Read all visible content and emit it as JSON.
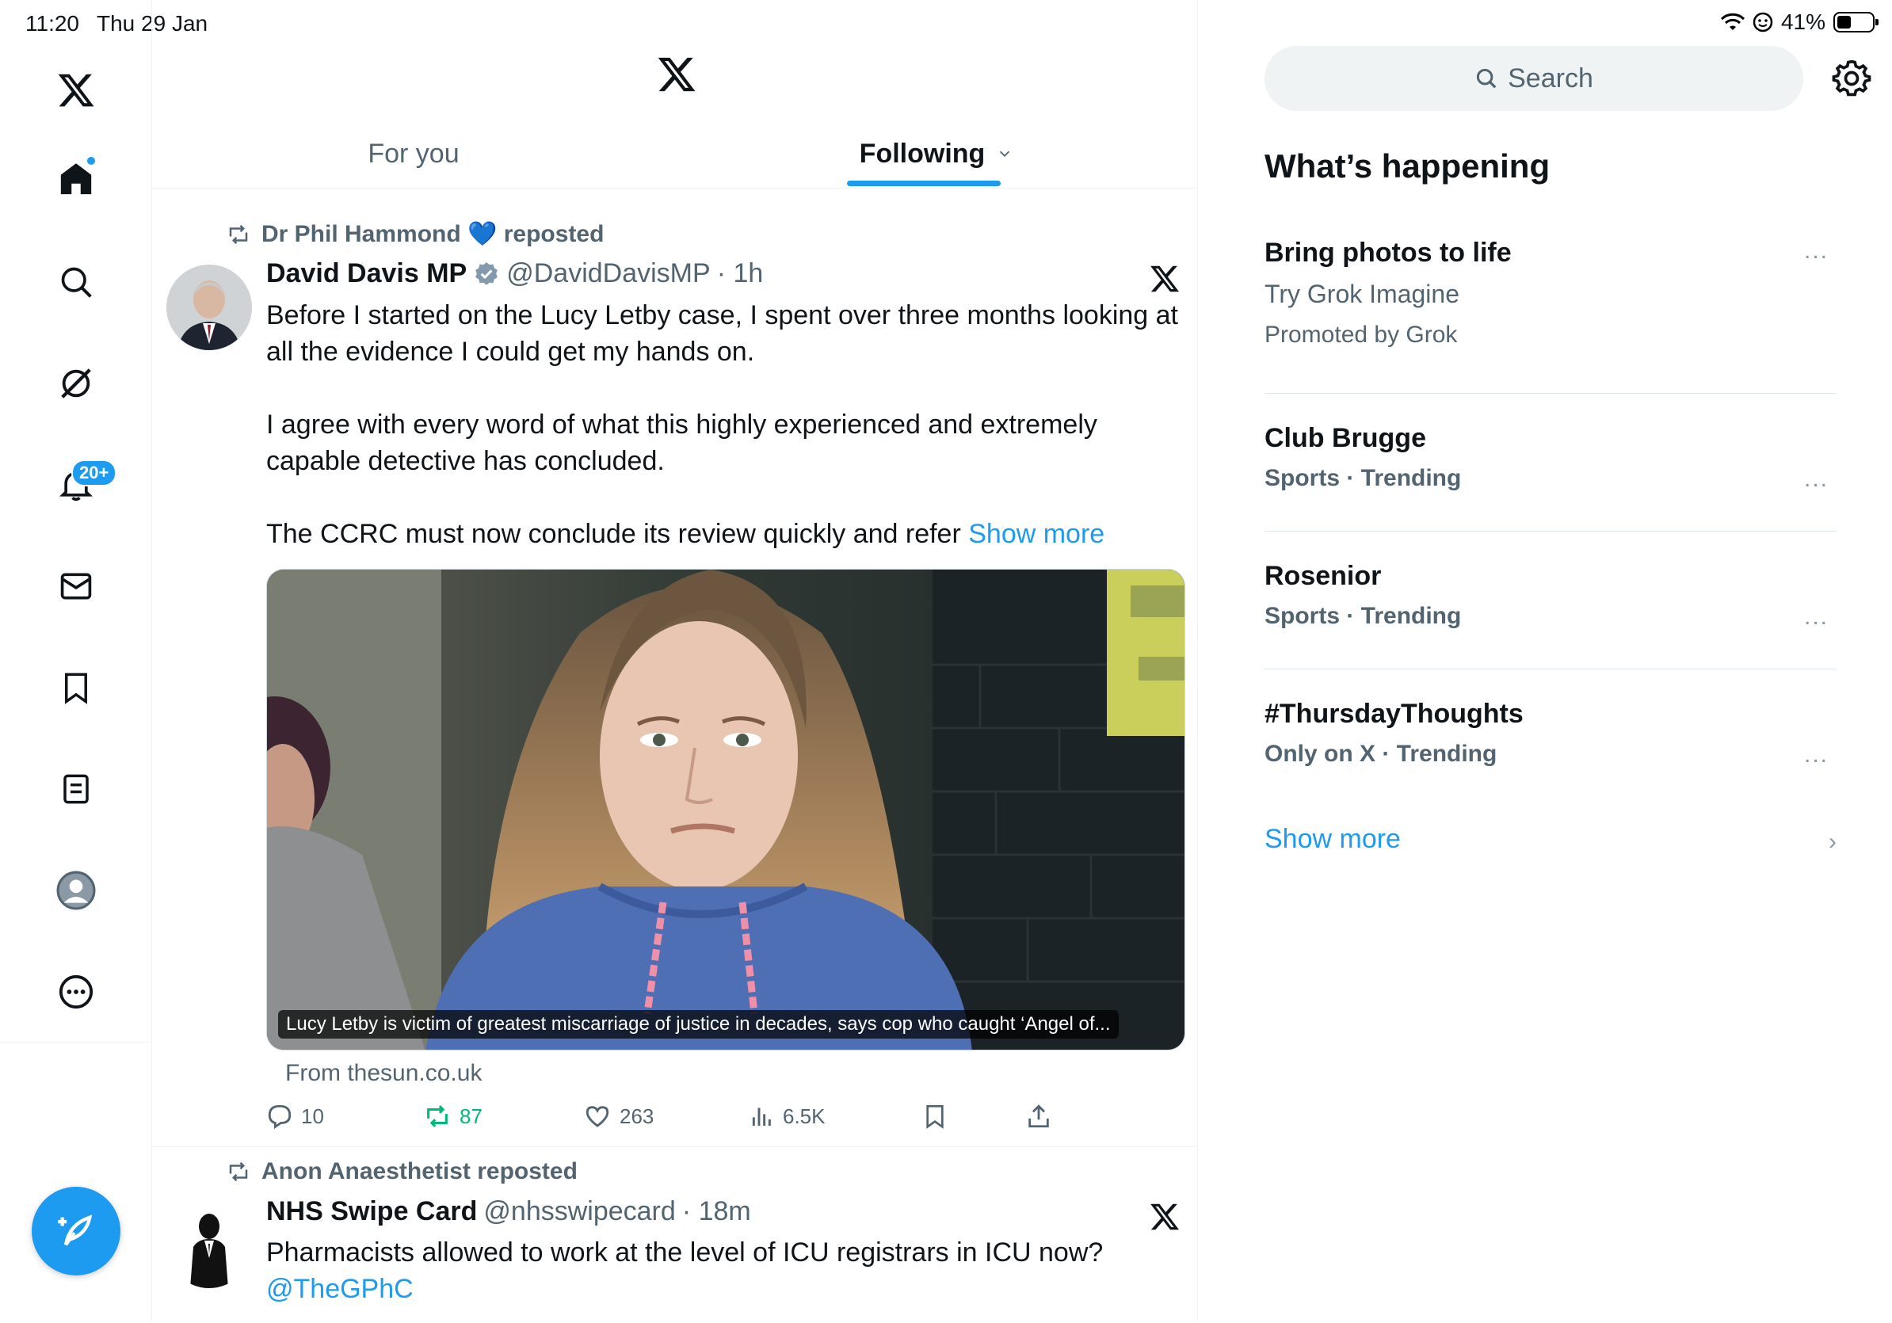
{
  "status_bar": {
    "time": "11:20",
    "date": "Thu 29 Jan",
    "battery": "41%",
    "battery_level": 0.41
  },
  "nav": {
    "notifications_badge": "20+"
  },
  "tabs": {
    "for_you": "For you",
    "following": "Following"
  },
  "post1": {
    "reposter": "Dr Phil Hammond 💙 reposted",
    "name": "David Davis MP",
    "handle": "@DavidDavisMP",
    "time": "· 1h",
    "paragraph1": "Before I started on the Lucy Letby case, I spent over three months looking at all the evidence I could get my hands on.",
    "paragraph2": "I agree with every word of what this highly experienced and extremely capable detective has concluded.",
    "paragraph3": "The CCRC must now conclude its review quickly and refer ",
    "show_more": "Show more",
    "media_caption": "Lucy Letby is victim of greatest miscarriage of justice in decades, says cop who caught ‘Angel of...",
    "source": "From thesun.co.uk",
    "replies": "10",
    "reposts": "87",
    "likes": "263",
    "views": "6.5K"
  },
  "post2": {
    "reposter": "Anon Anaesthetist reposted",
    "name": "NHS Swipe Card",
    "handle": "@nhsswipecard",
    "time": "· 18m",
    "text": "Pharmacists allowed to work at the level of ICU registrars in ICU now?",
    "mention": "@TheGPhC"
  },
  "sidebar": {
    "search_placeholder": "Search",
    "title": "What’s happening",
    "promo": {
      "title": "Bring photos to life",
      "subtitle": "Try Grok Imagine",
      "promoted": "Promoted by Grok"
    },
    "trends": [
      {
        "name": "Club Brugge",
        "meta": "Sports · Trending"
      },
      {
        "name": "Rosenior",
        "meta": "Sports · Trending"
      },
      {
        "name": "#ThursdayThoughts",
        "meta": "Only on X · Trending"
      }
    ],
    "more_icon": "...",
    "show_more": "Show more",
    "chevron": "›"
  }
}
